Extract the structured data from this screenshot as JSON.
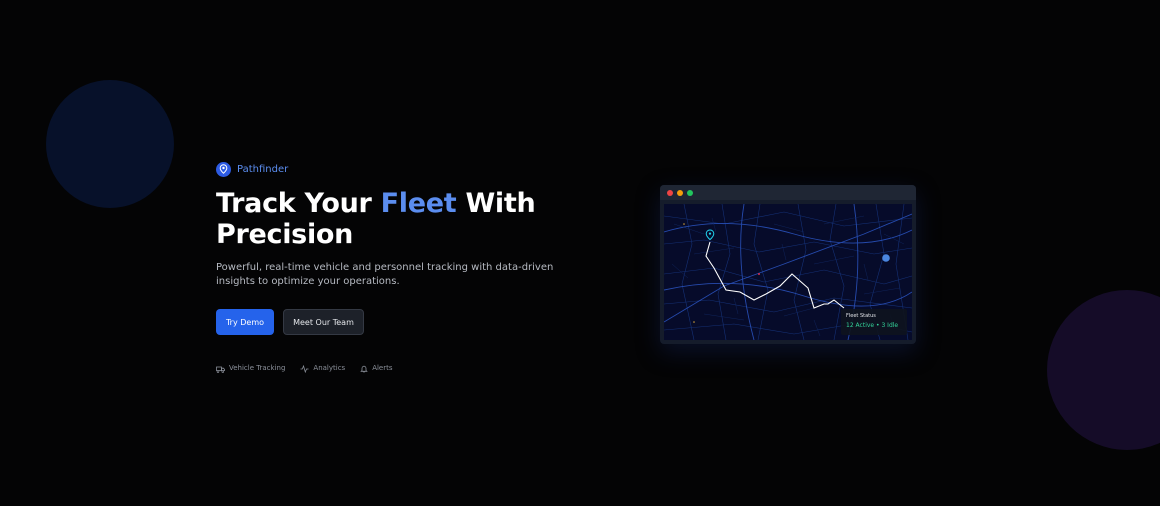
{
  "brand": {
    "name": "Pathfinder",
    "icon": "map-pin-icon",
    "color": "#2d5be3"
  },
  "hero": {
    "title_pre": "Track Your ",
    "title_accent": "Fleet",
    "title_post": " With",
    "title_line2": "Precision",
    "subtitle": "Powerful, real-time vehicle and personnel tracking with data-driven insights to optimize your operations."
  },
  "actions": {
    "primary_label": "Try Demo",
    "secondary_label": "Meet Our Team"
  },
  "features": [
    {
      "label": "Vehicle Tracking",
      "icon": "truck-icon"
    },
    {
      "label": "Analytics",
      "icon": "activity-icon"
    },
    {
      "label": "Alerts",
      "icon": "bell-icon"
    }
  ],
  "mockup": {
    "window_dots": [
      "#ef4444",
      "#f59e0b",
      "#22c55e"
    ],
    "status": {
      "title": "Fleet Status",
      "value": "12 Active • 3 Idle"
    }
  },
  "colors": {
    "accent": "#5b8def",
    "primary_button": "#2563eb",
    "background": "#040405",
    "status_green": "#34d399"
  }
}
